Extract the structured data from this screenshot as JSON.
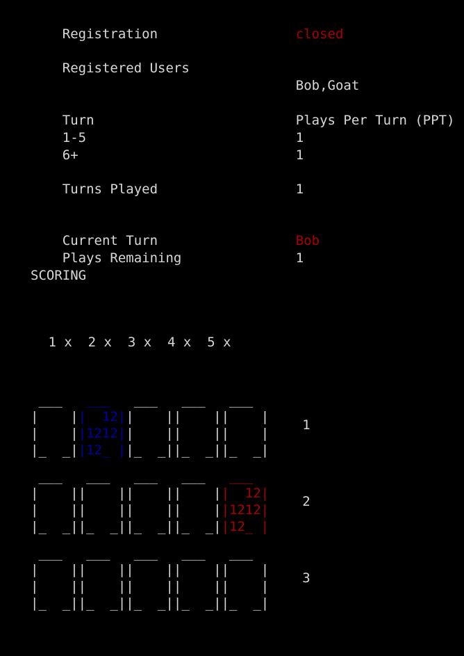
{
  "status": {
    "registration": {
      "label": "Registration",
      "value": "closed",
      "value_color": "#aa0000"
    },
    "registered_users": {
      "label": "Registered Users",
      "value": "Bob,Goat"
    },
    "ppt_table": {
      "turn_header": "Turn",
      "ppt_header": "Plays Per Turn (PPT)",
      "rows": [
        {
          "turn": "1-5",
          "ppt": "1"
        },
        {
          "turn": "6+",
          "ppt": "1"
        }
      ]
    },
    "turns_played": {
      "label": "Turns Played",
      "value": "1"
    },
    "current_turn": {
      "label": "Current Turn",
      "value": "Bob",
      "value_color": "#aa0000"
    },
    "plays_remaining": {
      "label": "Plays Remaining",
      "value": "1"
    }
  },
  "scoring": {
    "heading": "SCORING",
    "column_header": " 1 x  2 x  3 x  4 x  5 x",
    "columns": [
      "1 x",
      "2 x",
      "3 x",
      "4 x",
      "5 x"
    ],
    "empty_cell": {
      "top": " ___ ",
      "mid1": "|    |",
      "mid2": "|    |",
      "bot": "|_  _|"
    },
    "filled_cell": {
      "top": " ___ ",
      "mid1": "|  12|",
      "mid2": "|1212|",
      "bot": "|12_ |"
    },
    "rows": [
      {
        "score": "1",
        "cells": [
          {
            "state": "empty",
            "color": "#d8d8d8",
            "lines": [
              " ___ ",
              "|    |",
              "|    |",
              "|_  _|"
            ]
          },
          {
            "state": "filled",
            "color": "#0000aa",
            "lines": [
              " ___ ",
              "|  12|",
              "|1212|",
              "|12_ |"
            ]
          },
          {
            "state": "empty",
            "color": "#d8d8d8",
            "lines": [
              " ___ ",
              "|    |",
              "|    |",
              "|_  _|"
            ]
          },
          {
            "state": "empty",
            "color": "#d8d8d8",
            "lines": [
              " ___ ",
              "|    |",
              "|    |",
              "|_  _|"
            ]
          },
          {
            "state": "empty",
            "color": "#d8d8d8",
            "lines": [
              " ___ ",
              "|    |",
              "|    |",
              "|_  _|"
            ]
          }
        ]
      },
      {
        "score": "2",
        "cells": [
          {
            "state": "empty",
            "color": "#d8d8d8",
            "lines": [
              " ___ ",
              "|    |",
              "|    |",
              "|_  _|"
            ]
          },
          {
            "state": "empty",
            "color": "#d8d8d8",
            "lines": [
              " ___ ",
              "|    |",
              "|    |",
              "|_  _|"
            ]
          },
          {
            "state": "empty",
            "color": "#d8d8d8",
            "lines": [
              " ___ ",
              "|    |",
              "|    |",
              "|_  _|"
            ]
          },
          {
            "state": "empty",
            "color": "#d8d8d8",
            "lines": [
              " ___ ",
              "|    |",
              "|    |",
              "|_  _|"
            ]
          },
          {
            "state": "filled",
            "color": "#aa0000",
            "lines": [
              " ___ ",
              "|  12|",
              "|1212|",
              "|12_ |"
            ]
          }
        ]
      },
      {
        "score": "3",
        "cells": [
          {
            "state": "empty",
            "color": "#d8d8d8",
            "lines": [
              " ___ ",
              "|    |",
              "|    |",
              "|_  _|"
            ]
          },
          {
            "state": "empty",
            "color": "#d8d8d8",
            "lines": [
              " ___ ",
              "|    |",
              "|    |",
              "|_  _|"
            ]
          },
          {
            "state": "empty",
            "color": "#d8d8d8",
            "lines": [
              " ___ ",
              "|    |",
              "|    |",
              "|_  _|"
            ]
          },
          {
            "state": "empty",
            "color": "#d8d8d8",
            "lines": [
              " ___ ",
              "|    |",
              "|    |",
              "|_  _|"
            ]
          },
          {
            "state": "empty",
            "color": "#d8d8d8",
            "lines": [
              " ___ ",
              "|    |",
              "|    |",
              "|_  _|"
            ]
          }
        ]
      }
    ]
  },
  "theme": {
    "background": "#000000",
    "text": "#d8d8d8",
    "accent_red": "#aa0000",
    "accent_blue": "#0000aa"
  }
}
